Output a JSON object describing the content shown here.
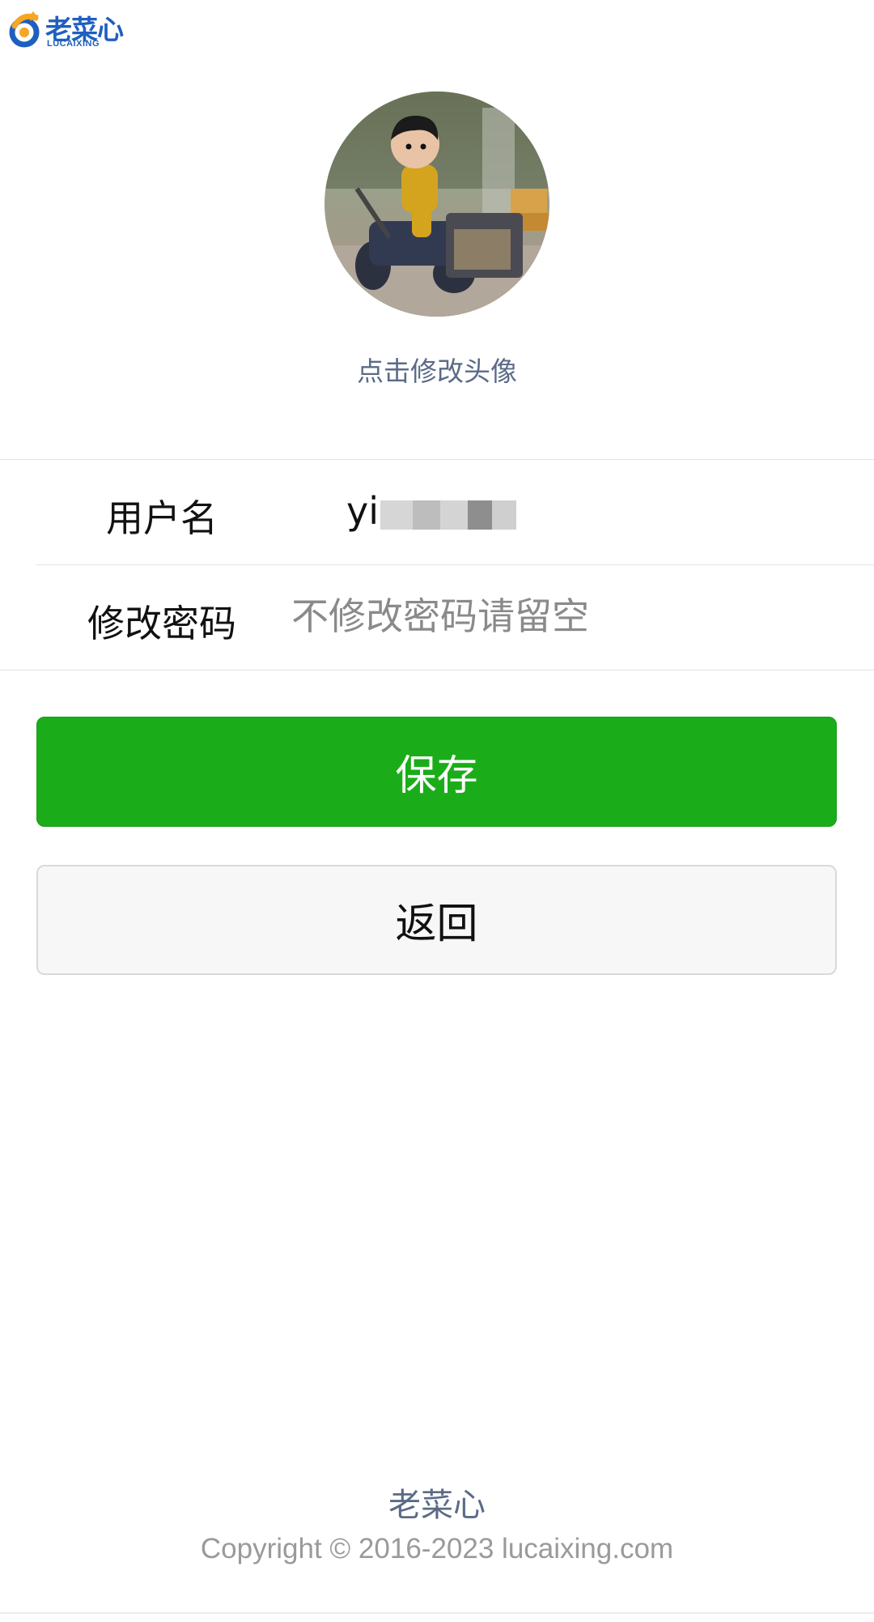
{
  "header": {
    "logo_text": "老菜心",
    "logo_sub": "LUCAIXING",
    "logo_icon": "lucaixing-logo-icon"
  },
  "profile": {
    "avatar_icon": "avatar-photo-image",
    "avatar_hint": "点击修改头像"
  },
  "form": {
    "username_label": "用户名",
    "username_value": "yiz",
    "password_label": "修改密码",
    "password_placeholder": "不修改密码请留空"
  },
  "actions": {
    "save_label": "保存",
    "back_label": "返回"
  },
  "footer": {
    "brand": "老菜心",
    "copyright": "Copyright © 2016-2023 lucaixing.com"
  },
  "colors": {
    "primary_green": "#1aad19",
    "link_gray_blue": "#5b6b86",
    "brand_blue": "#1f5fbf",
    "brand_orange": "#f5a623"
  }
}
